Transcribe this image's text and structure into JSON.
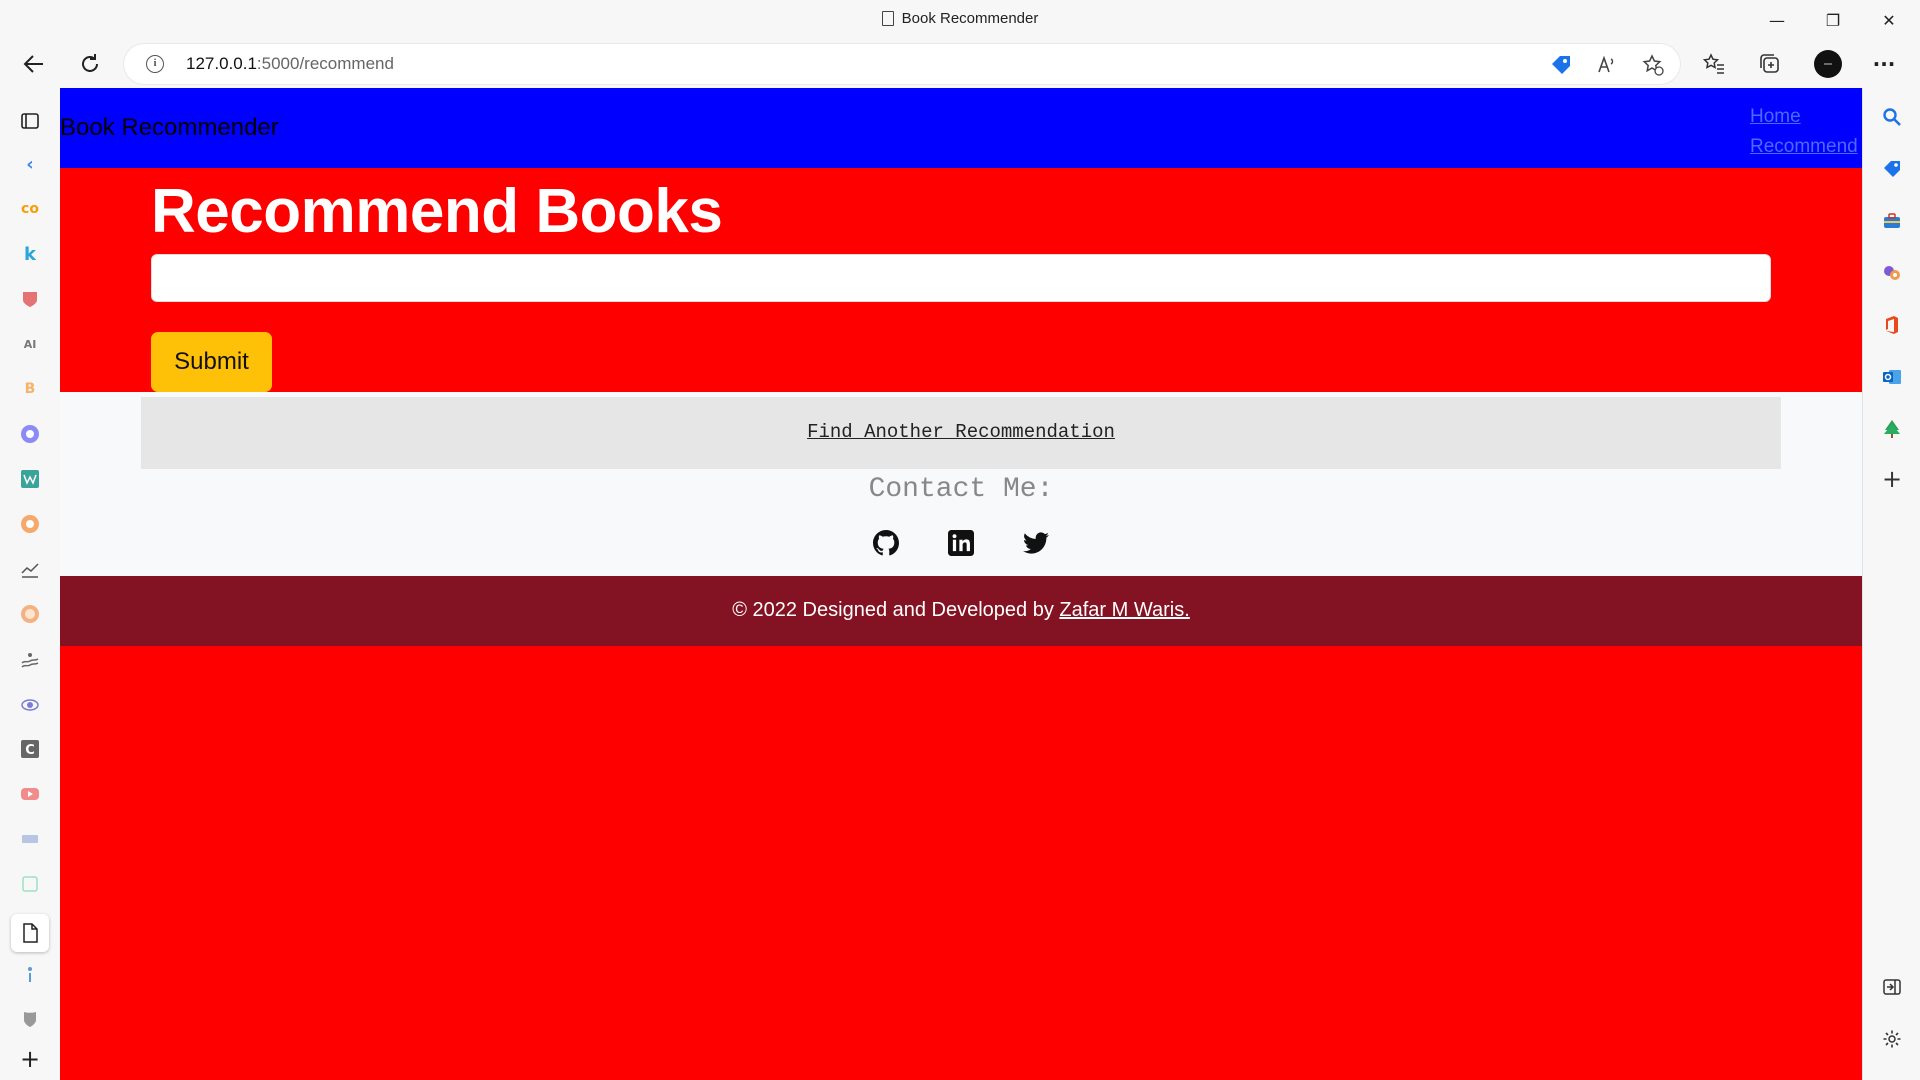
{
  "window": {
    "title": "Book Recommender",
    "controls": {
      "minimize": "—",
      "restore": "❐",
      "close": "✕"
    }
  },
  "toolbar": {
    "url_host": "127.0.0.1",
    "url_rest": ":5000/recommend",
    "more": "···"
  },
  "page": {
    "brand": "Book Recommender",
    "nav": [
      "Home",
      "Recommend"
    ],
    "heading": "Recommend Books",
    "input_value": "",
    "submit_label": "Submit",
    "find_link": "Find Another Recommendation",
    "contact_heading": "Contact Me:",
    "footer_text": "© 2022 Designed and Developed by ",
    "footer_link": "Zafar M Waris."
  },
  "colors": {
    "navbar": "#0000ff",
    "hero": "#ff0000",
    "submit": "#ffc107",
    "footer": "#831222"
  }
}
